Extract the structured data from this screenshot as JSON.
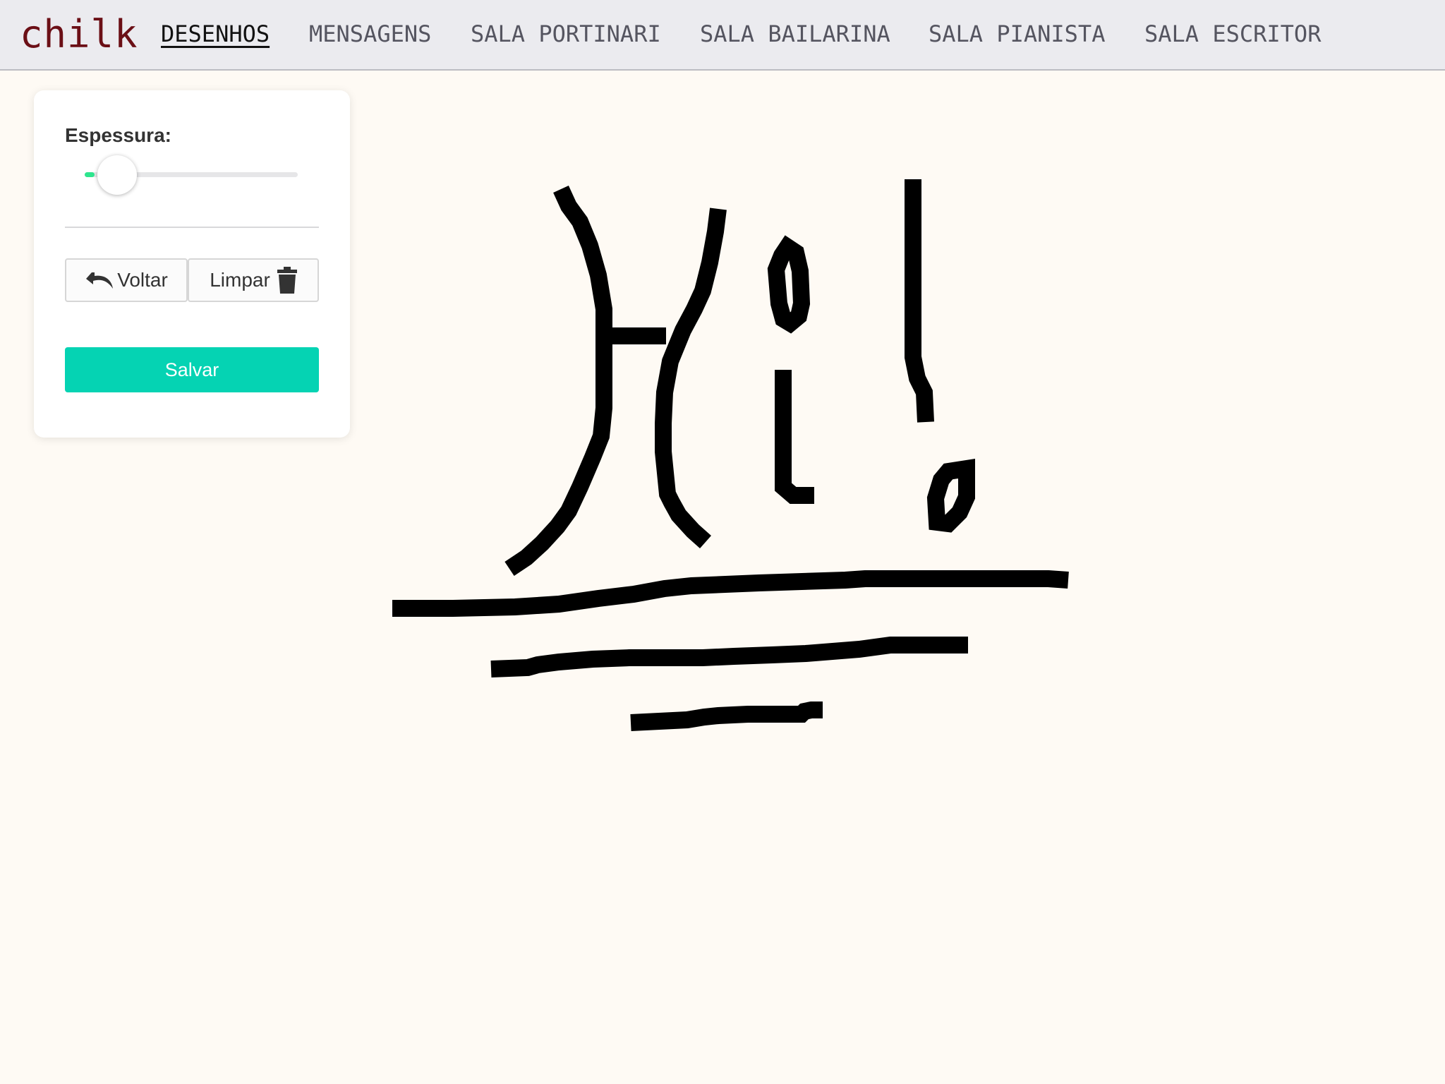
{
  "app": {
    "logo": "chilk"
  },
  "nav": {
    "items": [
      {
        "label": "DESENHOS",
        "active": true
      },
      {
        "label": "MENSAGENS",
        "active": false
      },
      {
        "label": "SALA PORTINARI",
        "active": false
      },
      {
        "label": "SALA BAILARINA",
        "active": false
      },
      {
        "label": "SALA PIANISTA",
        "active": false
      },
      {
        "label": "SALA ESCRITOR",
        "active": false
      }
    ]
  },
  "toolbar": {
    "thickness_label": "Espessura:",
    "thickness_value": 0.03,
    "back_label": "Voltar",
    "back_icon": "undo-icon",
    "clear_label": "Limpar",
    "clear_icon": "trash-icon",
    "save_label": "Salvar"
  },
  "colors": {
    "logo": "#6b0f16",
    "accent": "#05d3b3",
    "slider_fill": "#2ee58e",
    "canvas_background": "#fefaf4",
    "ink": "#000000"
  }
}
